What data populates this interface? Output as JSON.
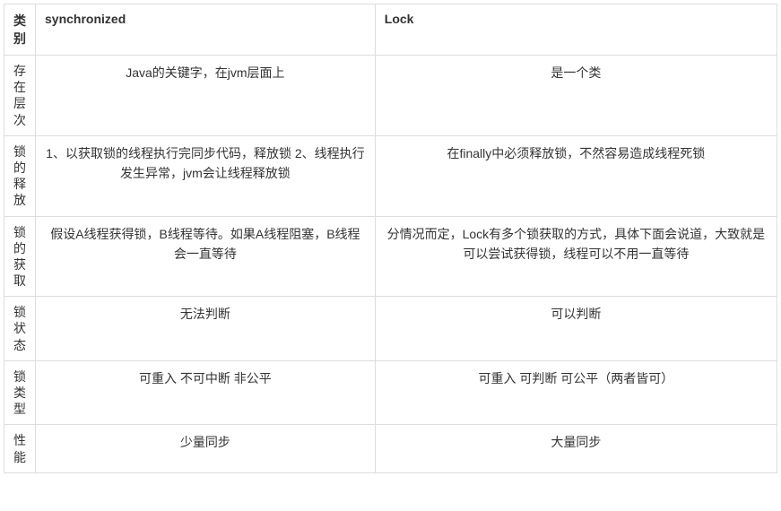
{
  "table": {
    "headers": {
      "category": "类别",
      "synchronized": "synchronized",
      "lock": "Lock"
    },
    "rows": [
      {
        "label": "存在层次",
        "sync": "Java的关键字，在jvm层面上",
        "lock": "是一个类"
      },
      {
        "label": "锁的释放",
        "sync": "1、以获取锁的线程执行完同步代码，释放锁 2、线程执行发生异常，jvm会让线程释放锁",
        "lock": "在finally中必须释放锁，不然容易造成线程死锁"
      },
      {
        "label": "锁的获取",
        "sync": "假设A线程获得锁，B线程等待。如果A线程阻塞，B线程会一直等待",
        "lock": "分情况而定，Lock有多个锁获取的方式，具体下面会说道，大致就是可以尝试获得锁，线程可以不用一直等待"
      },
      {
        "label": "锁状态",
        "sync": "无法判断",
        "lock": "可以判断"
      },
      {
        "label": "锁类型",
        "sync": "可重入 不可中断 非公平",
        "lock": "可重入 可判断 可公平（两者皆可）"
      },
      {
        "label": "性能",
        "sync": "少量同步",
        "lock": "大量同步"
      }
    ]
  }
}
